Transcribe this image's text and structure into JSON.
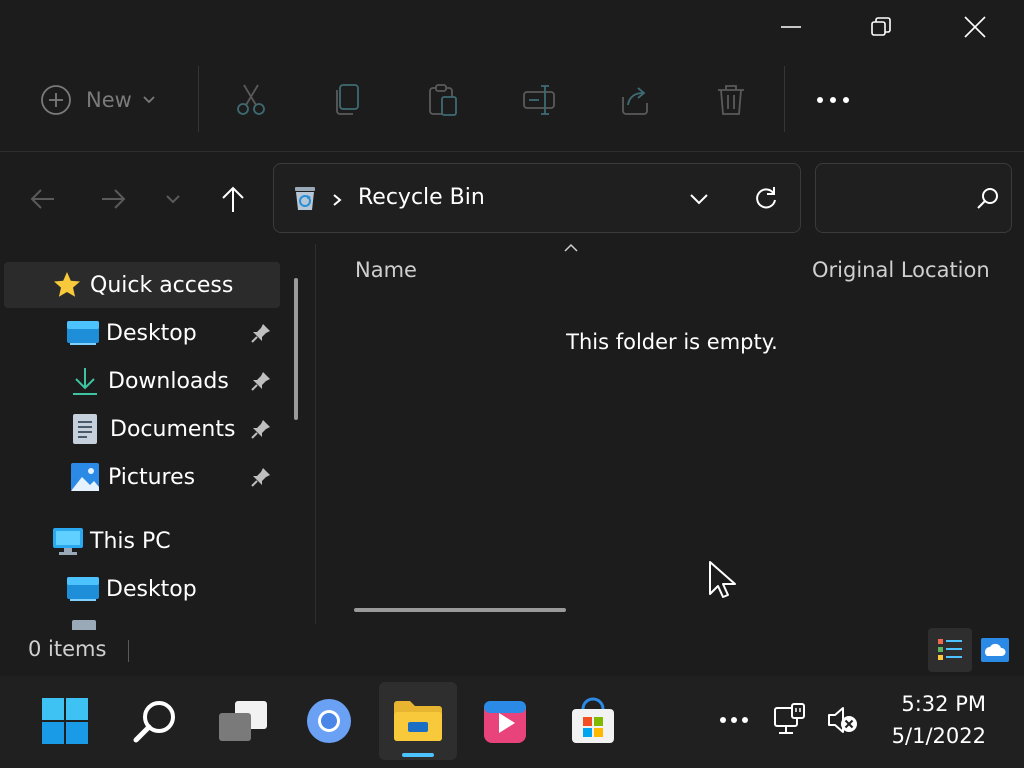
{
  "toolbar": {
    "new_label": "New",
    "icons": [
      "plus-circle-icon",
      "chevron-down-icon",
      "cut-icon",
      "copy-icon",
      "paste-icon",
      "rename-icon",
      "share-icon",
      "delete-icon",
      "more-icon"
    ]
  },
  "address": {
    "location": "Recycle Bin",
    "search_placeholder": ""
  },
  "sidebar": {
    "quick_access": "Quick access",
    "items": [
      {
        "label": "Desktop"
      },
      {
        "label": "Downloads"
      },
      {
        "label": "Documents"
      },
      {
        "label": "Pictures"
      }
    ],
    "this_pc": "This PC",
    "this_pc_items": [
      {
        "label": "Desktop"
      }
    ]
  },
  "content": {
    "columns": [
      "Name",
      "Original Location"
    ],
    "empty_message": "This folder is empty."
  },
  "status": {
    "item_count": "0 items"
  },
  "taskbar": {
    "time": "5:32 PM",
    "date": "5/1/2022"
  },
  "colors": {
    "background": "#1c1c1c",
    "accent": "#0078d4",
    "folder_yellow": "#f8c93b"
  }
}
